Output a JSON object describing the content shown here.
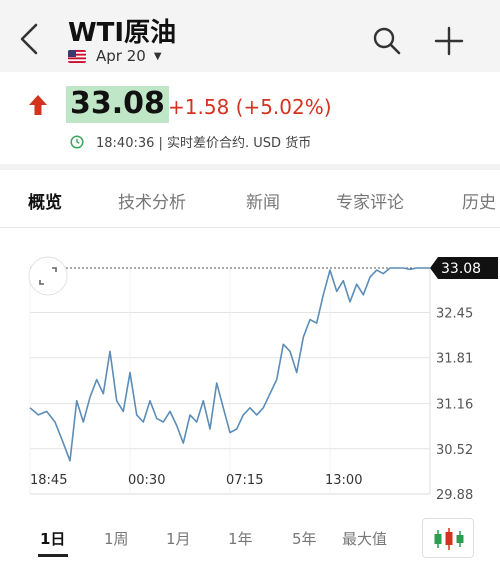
{
  "header": {
    "title": "WTI原油",
    "date_label": "Apr 20"
  },
  "quote": {
    "price": "33.08",
    "change": "+1.58 (+5.02%)",
    "meta": "18:40:36 | 实时差价合约.  USD 货币",
    "up_color": "#d3331f",
    "price_highlight": "#bfe6c6"
  },
  "tabs": [
    "概览",
    "技术分析",
    "新闻",
    "专家评论",
    "历史"
  ],
  "active_tab": "概览",
  "chart_data": {
    "type": "line",
    "x_ticks": [
      "18:45",
      "00:30",
      "07:15",
      "13:00"
    ],
    "y_ticks": [
      "33.08",
      "32.45",
      "31.81",
      "31.16",
      "30.52",
      "29.88"
    ],
    "ylim": [
      29.88,
      33.08
    ],
    "last_value": "33.08",
    "reference_line": 33.08,
    "line_color": "#5b8db8",
    "x": [
      0.0,
      0.5,
      1.0,
      1.5,
      2.0,
      2.4,
      2.8,
      3.2,
      3.6,
      4.0,
      4.4,
      4.8,
      5.2,
      5.6,
      6.0,
      6.4,
      6.8,
      7.2,
      7.6,
      8.0,
      8.4,
      8.8,
      9.2,
      9.6,
      10.0,
      10.4,
      10.8,
      11.2,
      11.6,
      12.0,
      12.4,
      12.8,
      13.2,
      13.6,
      14.0,
      14.4,
      14.8,
      15.2,
      15.6,
      16.0,
      16.4,
      16.8,
      17.2,
      17.6,
      18.0,
      18.4,
      18.8,
      19.2,
      19.6,
      20.0,
      20.4,
      20.8,
      21.2,
      21.6,
      22.0,
      22.4,
      22.8,
      23.2,
      23.6,
      24.0
    ],
    "y": [
      31.1,
      31.0,
      31.05,
      30.9,
      30.6,
      30.35,
      31.2,
      30.9,
      31.25,
      31.5,
      31.3,
      31.9,
      31.2,
      31.05,
      31.6,
      31.0,
      30.9,
      31.2,
      30.95,
      30.9,
      31.05,
      30.85,
      30.6,
      31.0,
      30.9,
      31.2,
      30.8,
      31.45,
      31.1,
      30.75,
      30.8,
      31.0,
      31.1,
      31.0,
      31.1,
      31.3,
      31.5,
      32.0,
      31.9,
      31.6,
      32.1,
      32.35,
      32.3,
      32.7,
      33.05,
      32.75,
      32.9,
      32.6,
      32.85,
      32.7,
      32.95,
      33.05,
      33.0,
      33.08,
      33.08,
      33.08,
      33.06,
      33.08,
      33.08,
      33.08
    ]
  },
  "ranges": [
    "1日",
    "1周",
    "1月",
    "1年",
    "5年",
    "最大值"
  ],
  "active_range": "1日"
}
